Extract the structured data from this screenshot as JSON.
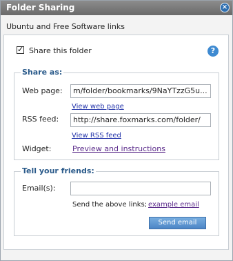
{
  "dialog": {
    "title": "Folder Sharing",
    "subtitle": "Ubuntu and Free Software links"
  },
  "share_folder": {
    "label": "Share this folder",
    "checked": true
  },
  "share_as": {
    "heading": "Share as:",
    "web_page_label": "Web page:",
    "web_page_value": "...m/folder/bookmarks/9NaYTzzG5u",
    "web_page_link": "View web page",
    "rss_label": "RSS feed:",
    "rss_value": "http://share.foxmarks.com/folder/",
    "rss_link": "View RSS feed",
    "widget_label": "Widget:",
    "widget_link": "Preview and instructions"
  },
  "tell_friends": {
    "heading": "Tell your friends:",
    "email_label": "Email(s):",
    "email_value": "",
    "send_note": "Send the above links;",
    "example_link": "example email",
    "send_button": "Send email"
  }
}
